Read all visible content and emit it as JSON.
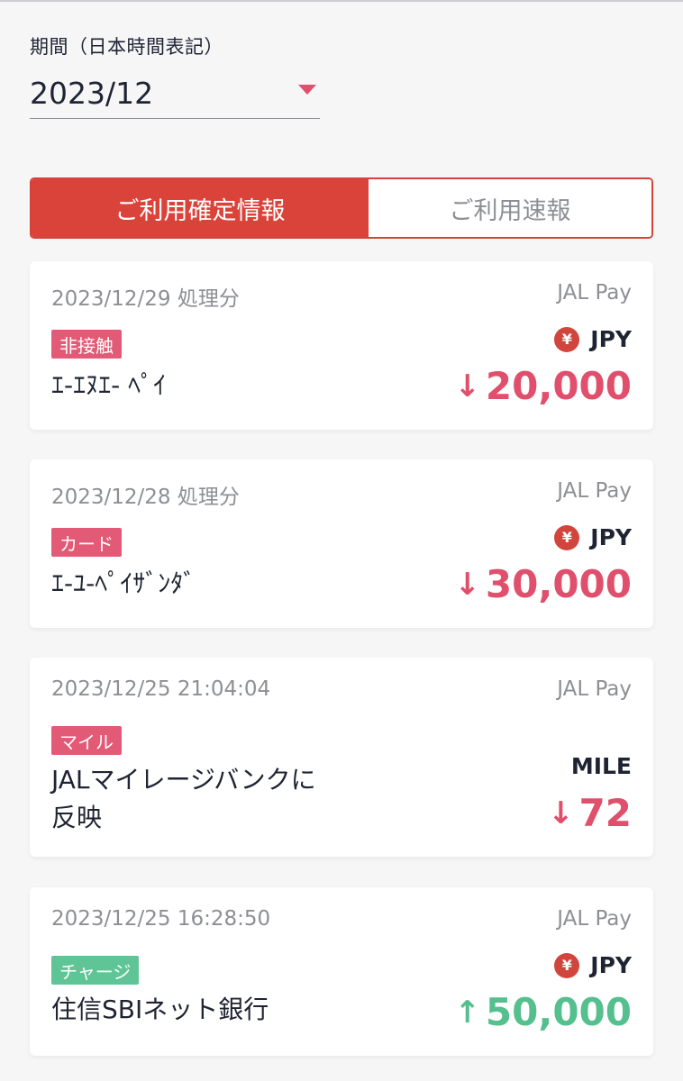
{
  "period": {
    "label": "期間（日本時間表記）",
    "selected": "2023/12"
  },
  "tabs": [
    {
      "label": "ご利用確定情報",
      "active": true
    },
    {
      "label": "ご利用速報",
      "active": false
    }
  ],
  "colors": {
    "accent_red": "#d9433a",
    "amount_down": "#e04f6b",
    "amount_up": "#55bf8e",
    "badge_pink": "#e25a76",
    "badge_green": "#5fc596"
  },
  "transactions": [
    {
      "date": "2023/12/29 処理分",
      "brand": "JAL Pay",
      "badge": "非接触",
      "merchant": "ｴ-ｴﾇｴ- ﾍﾟｲ",
      "currency_icon": "¥",
      "currency": "JPY",
      "direction": "down",
      "arrow": "↓",
      "amount": "20,000"
    },
    {
      "date": "2023/12/28 処理分",
      "brand": "JAL Pay",
      "badge": "カード",
      "merchant": "ｴ-ﾕ-ﾍﾟｲｻﾞﾝﾀﾞ",
      "currency_icon": "¥",
      "currency": "JPY",
      "direction": "down",
      "arrow": "↓",
      "amount": "30,000"
    },
    {
      "date": "2023/12/25 21:04:04",
      "brand": "JAL Pay",
      "badge": "マイル",
      "merchant_line1": "JALマイレージバンクに",
      "merchant_line2": "反映",
      "currency": "MILE",
      "direction": "down",
      "arrow": "↓",
      "amount": "72"
    },
    {
      "date": "2023/12/25 16:28:50",
      "brand": "JAL Pay",
      "badge": "チャージ",
      "merchant": "住信SBIネット銀行",
      "currency_icon": "¥",
      "currency": "JPY",
      "direction": "up",
      "arrow": "↑",
      "amount": "50,000"
    }
  ]
}
